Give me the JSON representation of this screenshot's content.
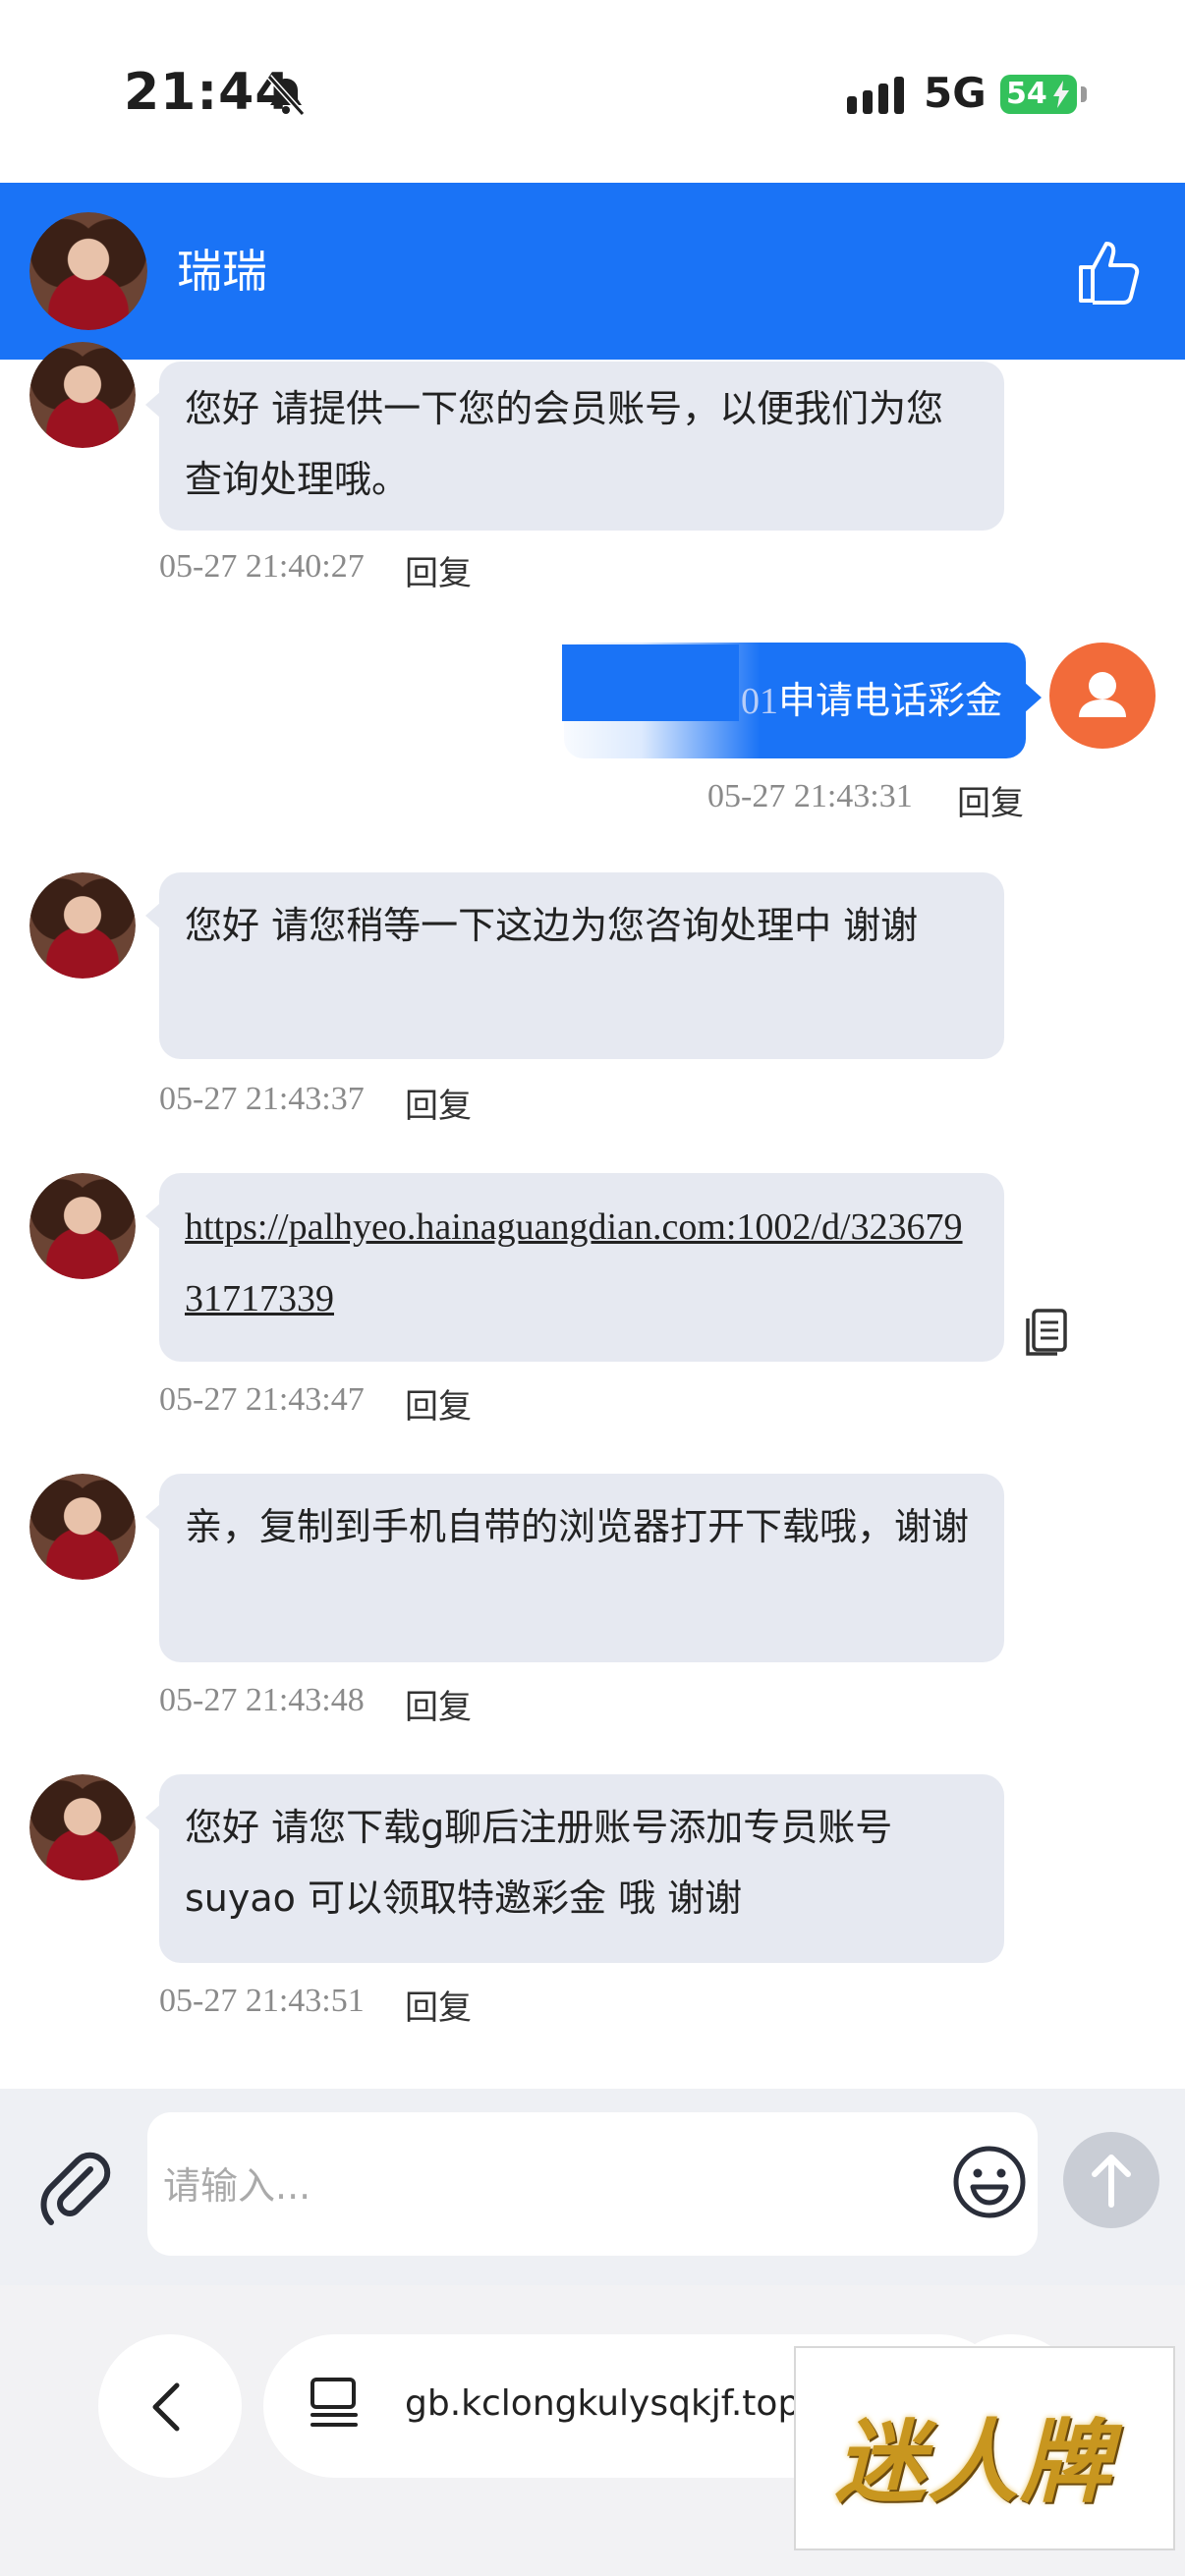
{
  "status_bar": {
    "time": "21:44",
    "network": "5G",
    "battery": "54"
  },
  "header": {
    "agent_name": "瑞瑞",
    "bg_color": "#1a73f6"
  },
  "messages": [
    {
      "text": "您好 请提供一下您的会员账号，以便我们为您查询处理哦。",
      "time": "05-27 21:40:27",
      "reply": "回复"
    },
    {
      "outgoing": true,
      "text": "申请电话彩金",
      "text_partial_prefix": "01",
      "time": "05-27 21:43:31",
      "reply": "回复"
    },
    {
      "text": "您好  请您稍等一下这边为您咨询处理中 谢谢",
      "time": "05-27 21:43:37",
      "reply": "回复"
    },
    {
      "text": "https://palhyeo.hainaguangdian.com:1002/d/32367931717339",
      "time": "05-27 21:43:47",
      "reply": "回复"
    },
    {
      "text": "亲，复制到手机自带的浏览器打开下载哦，谢谢",
      "time": "05-27 21:43:48",
      "reply": "回复"
    },
    {
      "text": "您好 请您下载g聊后注册账号添加专员账号suyao 可以领取特邀彩金 哦 谢谢",
      "time": "05-27 21:43:51",
      "reply": "回复"
    }
  ],
  "input": {
    "placeholder": "请输入..."
  },
  "browser": {
    "url": "gb.kclongkulysqkjf.top"
  },
  "watermark": {
    "text": "迷人牌"
  }
}
